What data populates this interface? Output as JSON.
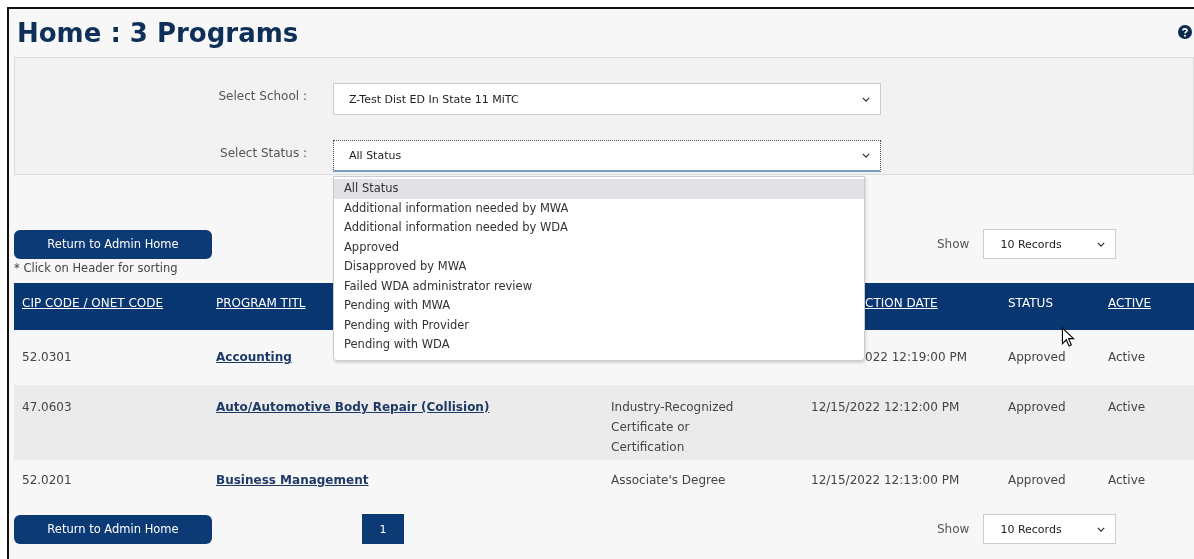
{
  "title": "Home : 3 Programs",
  "filters": [
    {
      "label": "Select School :",
      "value": "Z-Test Dist ED In State 11 MiTC",
      "focused": false
    },
    {
      "label": "Select Status :",
      "value": "All Status",
      "focused": true,
      "expanded": true
    }
  ],
  "status_options": [
    {
      "label": "All Status",
      "selected": true
    },
    {
      "label": "Additional information needed by MWA",
      "selected": false
    },
    {
      "label": "Additional information needed by WDA",
      "selected": false
    },
    {
      "label": "Approved",
      "selected": false
    },
    {
      "label": "Disapproved by MWA",
      "selected": false
    },
    {
      "label": "Failed WDA administrator review",
      "selected": false
    },
    {
      "label": "Pending with MWA",
      "selected": false
    },
    {
      "label": "Pending with Provider",
      "selected": false
    },
    {
      "label": "Pending with WDA",
      "selected": false
    }
  ],
  "return_button": "Return to Admin Home",
  "sort_note": "* Click on Header for sorting",
  "show_label": "Show",
  "records_select": "10 Records",
  "table": {
    "columns": [
      {
        "label": "CIP CODE / ONET CODE",
        "sortable": true
      },
      {
        "label": "PROGRAM TITL",
        "sortable": true
      },
      null,
      {
        "label": "CTION DATE",
        "sortable": true,
        "cut": true
      },
      {
        "label": "STATUS",
        "sortable": false
      },
      {
        "label": "ACTIVE",
        "sortable": true
      }
    ],
    "rows": [
      {
        "cells": [
          {
            "kind": "text",
            "text": "52.0301"
          },
          {
            "kind": "link",
            "text": "Accounting"
          },
          null,
          {
            "kind": "text",
            "text": "022 12:19:00 PM",
            "cut": true
          },
          {
            "kind": "text",
            "text": "Approved"
          },
          {
            "kind": "text",
            "text": "Active"
          }
        ]
      },
      {
        "cells": [
          {
            "kind": "text",
            "text": "47.0603"
          },
          {
            "kind": "link",
            "text": "Auto/Automotive Body Repair (Collision)"
          },
          {
            "kind": "text",
            "text": "Industry-Recognized Certificate or Certification"
          },
          {
            "kind": "text",
            "text": "12/15/2022 12:12:00 PM"
          },
          {
            "kind": "text",
            "text": "Approved"
          },
          {
            "kind": "text",
            "text": "Active"
          }
        ]
      },
      {
        "cells": [
          {
            "kind": "text",
            "text": "52.0201"
          },
          {
            "kind": "link",
            "text": "Business Management"
          },
          {
            "kind": "text",
            "text": "Associate's Degree"
          },
          {
            "kind": "text",
            "text": "12/15/2022 12:13:00 PM"
          },
          {
            "kind": "text",
            "text": "Approved"
          },
          {
            "kind": "text",
            "text": "Active"
          }
        ]
      }
    ]
  },
  "pager": [
    {
      "label": "1",
      "selected": true
    }
  ],
  "bottom_return_button": "Return to Admin Home",
  "bottom_show_label": "Show",
  "bottom_records_select": "10 Records"
}
